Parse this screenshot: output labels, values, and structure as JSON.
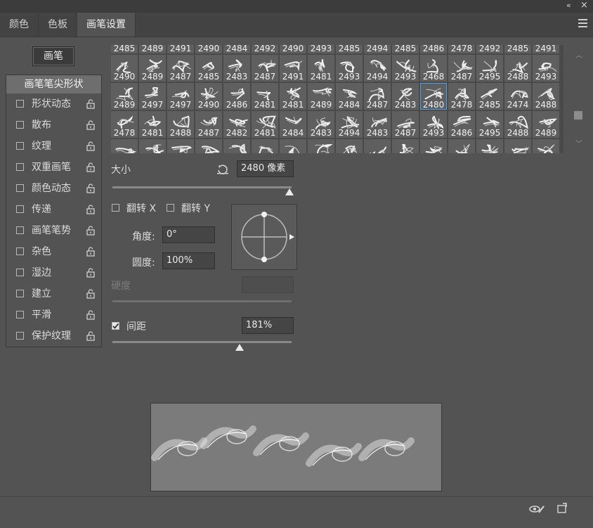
{
  "tabs": [
    {
      "label": "颜色"
    },
    {
      "label": "色板"
    },
    {
      "label": "画笔设置"
    }
  ],
  "window_controls": {
    "collapse": "«",
    "close": "×"
  },
  "presets_button": "画笔",
  "sidebar": {
    "header": "画笔笔尖形状",
    "items": [
      {
        "label": "形状动态"
      },
      {
        "label": "散布"
      },
      {
        "label": "纹理"
      },
      {
        "label": "双重画笔"
      },
      {
        "label": "颜色动态"
      },
      {
        "label": "传递"
      },
      {
        "label": "画笔笔势"
      },
      {
        "label": "杂色"
      },
      {
        "label": "湿边"
      },
      {
        "label": "建立"
      },
      {
        "label": "平滑"
      },
      {
        "label": "保护纹理"
      }
    ]
  },
  "brush_rows": [
    [
      "2485",
      "2489",
      "2491",
      "2490",
      "2484",
      "2492",
      "2490",
      "2493",
      "2485",
      "2494",
      "2485",
      "2486",
      "2478",
      "2492",
      "2485",
      "2491"
    ],
    [
      "2490",
      "2489",
      "2487",
      "2485",
      "2483",
      "2487",
      "2491",
      "2481",
      "2493",
      "2494",
      "2493",
      "2468",
      "2487",
      "2495",
      "2488",
      "2493"
    ],
    [
      "2489",
      "2497",
      "2497",
      "2490",
      "2486",
      "2481",
      "2481",
      "2489",
      "2484",
      "2487",
      "2483",
      "2480",
      "2478",
      "2485",
      "2474",
      "2488"
    ],
    [
      "2478",
      "2481",
      "2488",
      "2487",
      "2482",
      "2481",
      "2484",
      "2483",
      "2494",
      "2483",
      "2487",
      "2493",
      "2486",
      "2495",
      "2488",
      "2489"
    ],
    [
      "",
      "",
      "",
      "",
      "",
      "",
      "",
      "",
      "",
      "",
      "",
      "",
      "",
      "",
      "",
      ""
    ]
  ],
  "selected_brush": {
    "row": 2,
    "col": 11
  },
  "size": {
    "label": "大小",
    "value": "2480 像素",
    "fraction": 0.99
  },
  "flip_x": {
    "label": "翻转 X",
    "checked": false
  },
  "flip_y": {
    "label": "翻转 Y",
    "checked": false
  },
  "angle": {
    "label": "角度:",
    "value": "0°"
  },
  "roundness": {
    "label": "圆度:",
    "value": "100%"
  },
  "hardness": {
    "label": "硬度",
    "value": ""
  },
  "spacing": {
    "label": "间距",
    "value": "181%",
    "checked": true,
    "fraction": 0.71
  }
}
